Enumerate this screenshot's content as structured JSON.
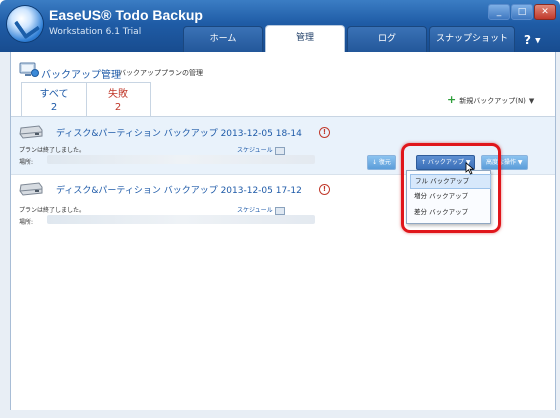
{
  "app": {
    "name": "EaseUS® Todo Backup",
    "edition": "Workstation 6.1 Trial"
  },
  "window_buttons": {
    "minimize": "_",
    "maximize": "□",
    "close": "✕"
  },
  "tabs": [
    {
      "label": "ホーム",
      "active": false
    },
    {
      "label": "管理",
      "active": true
    },
    {
      "label": "ログ",
      "active": false
    },
    {
      "label": "スナップショット",
      "active": false
    }
  ],
  "help": {
    "label": "?",
    "arrow": "▼"
  },
  "header": {
    "title": "バックアップ管理",
    "subtitle": "バックアッププランの管理"
  },
  "filters": [
    {
      "label": "すべて",
      "count": "2"
    },
    {
      "label": "失敗",
      "count": "2"
    }
  ],
  "new_backup": {
    "plus": "+",
    "label": "新規バックアップ(N)",
    "arrow": "▼"
  },
  "jobs": [
    {
      "name": "ディスク&パーティション バックアップ 2013-12-05 18-14",
      "alert": "!",
      "status": "プランは終了しました。",
      "location_label": "場所:",
      "schedule_label": "スケジュール"
    },
    {
      "name": "ディスク&パーティション バックアップ 2013-12-05 17-12",
      "alert": "!",
      "status": "プランは終了しました。",
      "location_label": "場所:",
      "schedule_label": "スケジュール"
    }
  ],
  "actions": {
    "restore": "↓ 復元",
    "backup": "↑ バックアップ ▼",
    "more": "高度な操作 ▼"
  },
  "backup_menu": {
    "items": [
      "フル バックアップ",
      "増分 バックアップ",
      "差分 バックアップ"
    ]
  },
  "colors": {
    "accent": "#1e5aa8",
    "fail": "#c0392b",
    "highlight": "#e0161b"
  }
}
